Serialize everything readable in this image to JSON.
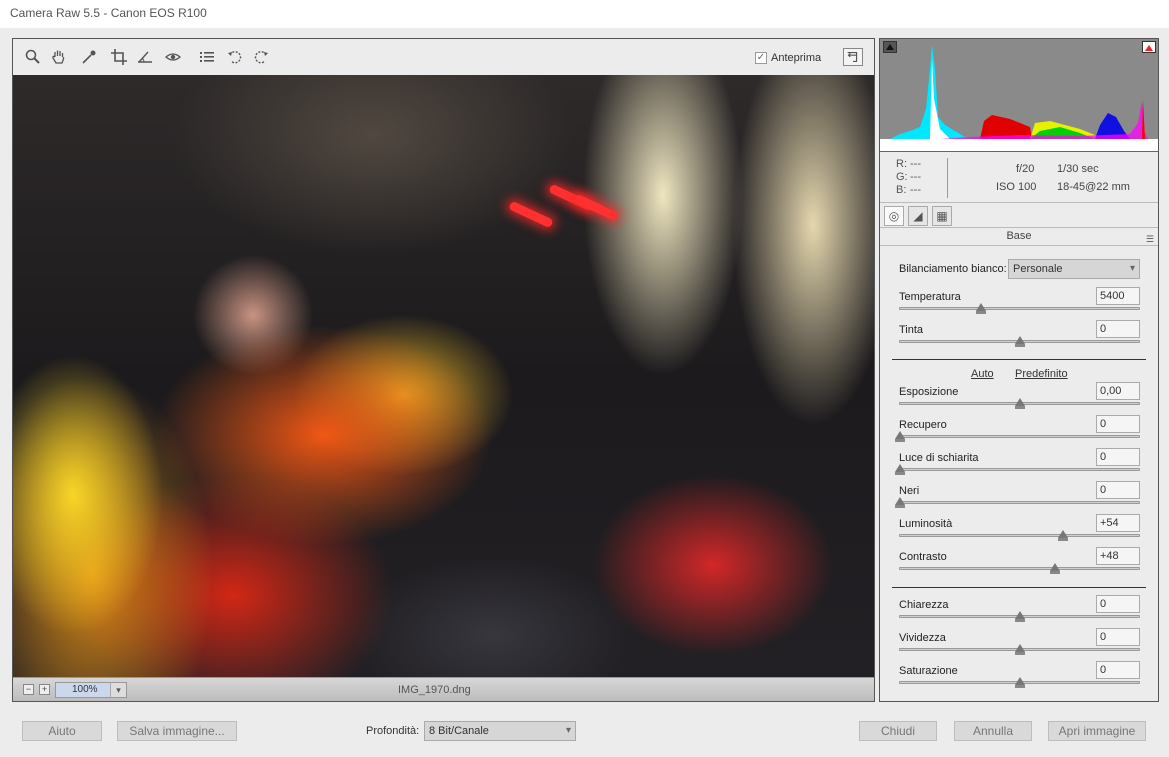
{
  "window": {
    "title": "Camera Raw 5.5  -  Canon EOS R100"
  },
  "toolbar": {
    "tools": [
      "zoom-icon",
      "hand-icon",
      "eyedropper-icon",
      "crop-icon",
      "straighten-icon",
      "red-eye-icon",
      "list-icon",
      "rotate-left-icon",
      "rotate-right-icon"
    ],
    "preview_label": "Anteprima",
    "preview_checked": "✓"
  },
  "status": {
    "zoom_out": "−",
    "zoom_in": "+",
    "zoom_value": "100%",
    "zoom_chevron": "▾",
    "filename": "IMG_1970.dng"
  },
  "info": {
    "r_label": "R:",
    "g_label": "G:",
    "b_label": "B:",
    "r_value": "---",
    "g_value": "---",
    "b_value": "---",
    "aperture": "f/20",
    "shutter": "1/30 sec",
    "iso": "ISO 100",
    "lens": "18-45@22 mm"
  },
  "tabs": {
    "basic": "◎",
    "tone_curve": "◢",
    "detail": "▦"
  },
  "section": {
    "title": "Base",
    "menu": "☰"
  },
  "white_balance": {
    "label": "Bilanciamento bianco:",
    "value": "Personale",
    "chevron": "▾"
  },
  "controls_wb": [
    {
      "label": "Temperatura",
      "value": "5400",
      "position": 0.34
    },
    {
      "label": "Tinta",
      "value": "0",
      "position": 0.5
    }
  ],
  "links": {
    "auto": "Auto",
    "default": "Predefinito"
  },
  "controls_tone": [
    {
      "label": "Esposizione",
      "value": "0,00",
      "position": 0.5
    },
    {
      "label": "Recupero",
      "value": "0",
      "position": 0.0
    },
    {
      "label": "Luce di schiarita",
      "value": "0",
      "position": 0.0
    },
    {
      "label": "Neri",
      "value": "0",
      "position": 0.0
    },
    {
      "label": "Luminosità",
      "value": "+54",
      "position": 0.68
    },
    {
      "label": "Contrasto",
      "value": "+48",
      "position": 0.65
    }
  ],
  "controls_presence": [
    {
      "label": "Chiarezza",
      "value": "0",
      "position": 0.5
    },
    {
      "label": "Vividezza",
      "value": "0",
      "position": 0.5
    },
    {
      "label": "Saturazione",
      "value": "0",
      "position": 0.5
    }
  ],
  "bottom": {
    "help": "Aiuto",
    "save": "Salva immagine...",
    "depth_label": "Profondità:",
    "depth_value": "8 Bit/Canale",
    "depth_chevron": "▾",
    "close": "Chiudi",
    "cancel": "Annulla",
    "open": "Apri immagine"
  }
}
